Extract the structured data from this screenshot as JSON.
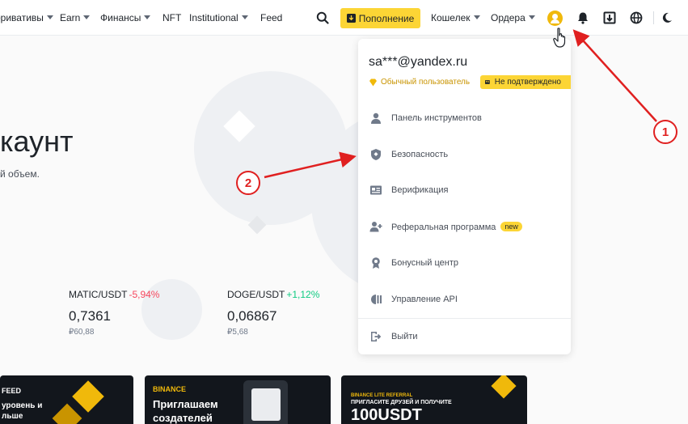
{
  "nav": {
    "items": [
      {
        "label": "оривативы",
        "caret": true
      },
      {
        "label": "Earn",
        "caret": true
      },
      {
        "label": "Финансы",
        "caret": true
      },
      {
        "label": "NFT",
        "caret": false
      },
      {
        "label": "Institutional",
        "caret": true
      },
      {
        "label": "Feed",
        "caret": false
      }
    ],
    "deposit_label": "Пополнение",
    "wallet_label": "Кошелек",
    "orders_label": "Ордера"
  },
  "hero": {
    "title": "каунт",
    "subtitle": "й объем."
  },
  "tickers": [
    {
      "pair": "MATIC/USDT",
      "change": "-5,94%",
      "change_color": "#f6465d",
      "price": "0,7361",
      "fiat": "₽60,88"
    },
    {
      "pair": "DOGE/USDT",
      "change": "+1,12%",
      "change_color": "#0ecb81",
      "price": "0,06867",
      "fiat": "₽5,68"
    }
  ],
  "banners": {
    "b1_line1": "FEED",
    "b1_line2": "уровень и",
    "b1_line3": "льше",
    "b2_brand": "BINANCE",
    "b2_line1": "Приглашаем",
    "b2_line2": "создателей",
    "b3_small": "BINANCE LITE REFERRAL",
    "b3_line1": "ПРИГЛАСИТЕ ДРУЗЕЙ И ПОЛУЧИТЕ",
    "b3_big": "100USDT"
  },
  "account_menu": {
    "email": "sa***@yandex.ru",
    "user_type": "Обычный пользователь",
    "verification_status": "Не подтверждено",
    "items": [
      {
        "label": "Панель инструментов",
        "icon": "user-icon"
      },
      {
        "label": "Безопасность",
        "icon": "shield-icon"
      },
      {
        "label": "Верификация",
        "icon": "id-card-icon"
      },
      {
        "label": "Реферальная программа",
        "icon": "add-user-icon",
        "badge": "new"
      },
      {
        "label": "Бонусный центр",
        "icon": "medal-icon"
      },
      {
        "label": "Управление API",
        "icon": "api-icon"
      },
      {
        "label": "Выйти",
        "icon": "logout-icon"
      }
    ]
  },
  "annotations": [
    "1",
    "2"
  ],
  "colors": {
    "brand_yellow": "#fcd535",
    "annotation_red": "#e02020"
  }
}
